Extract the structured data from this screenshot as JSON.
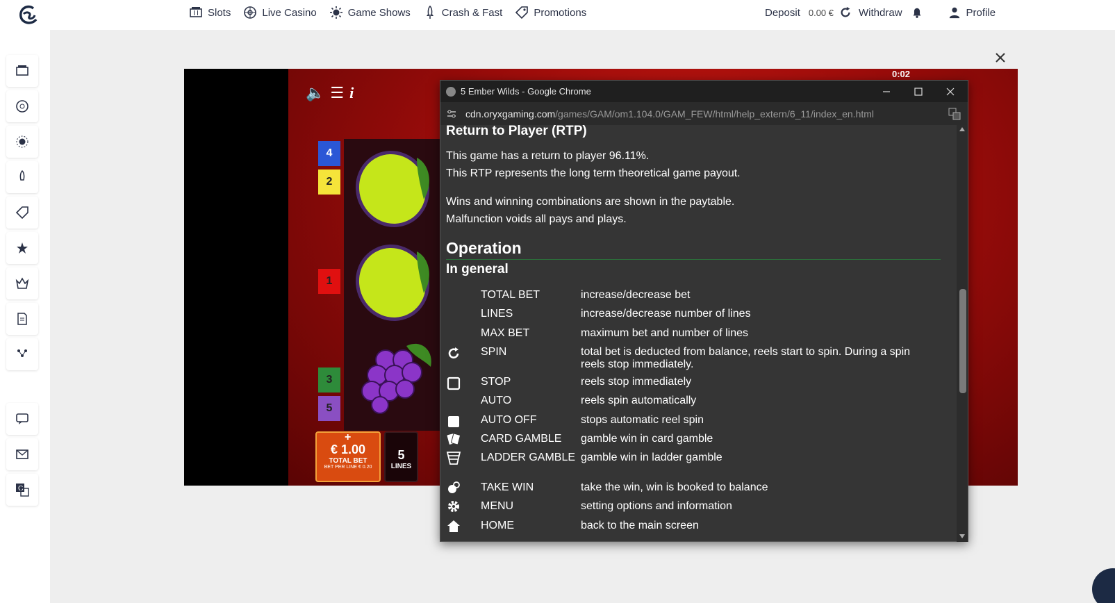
{
  "header": {
    "nav": [
      {
        "label": "Slots",
        "icon": "slot-machine-icon"
      },
      {
        "label": "Live Casino",
        "icon": "roulette-wheel-icon"
      },
      {
        "label": "Game Shows",
        "icon": "sparkle-wheel-icon"
      },
      {
        "label": "Crash & Fast",
        "icon": "rocket-icon"
      },
      {
        "label": "Promotions",
        "icon": "tag-icon"
      }
    ],
    "deposit_label": "Deposit",
    "balance": "0.00 €",
    "withdraw_label": "Withdraw",
    "profile_label": "Profile"
  },
  "sidebar": {
    "icons": [
      "slots-icon",
      "live-casino-icon",
      "game-shows-icon",
      "crash-icon",
      "promotions-icon",
      "vip-icon",
      "tournaments-icon",
      "document-icon",
      "missions-icon",
      "chat-icon",
      "mail-icon",
      "translate-icon"
    ]
  },
  "game": {
    "timer": "0:02",
    "reel_numbers": {
      "a": "4",
      "b": "2",
      "c": "1",
      "d": "3",
      "e": "5"
    },
    "bet_amount": "€ 1.00",
    "bet_label": "TOTAL BET",
    "bet_per_line": "BET PER LINE € 0.20",
    "lines_value": "5",
    "lines_label": "LINES"
  },
  "popup": {
    "title": "5 Ember Wilds - Google Chrome",
    "url_host": "cdn.oryxgaming.com",
    "url_path": "/games/GAM/om1.104.0/GAM_FEW/html/help_extern/6_11/index_en.html",
    "rtp_heading": "Return to Player (RTP)",
    "rtp_line1": "This game has a return to player 96.11%.",
    "rtp_line2": "This RTP represents the long term theoretical game payout.",
    "wins_line1": "Wins and winning combinations are shown in the paytable.",
    "wins_line2": "Malfunction voids all pays and plays.",
    "operation_heading": "Operation",
    "general_heading": "In general",
    "operations": [
      {
        "key": "TOTAL BET",
        "desc": "increase/decrease bet",
        "icon": ""
      },
      {
        "key": "LINES",
        "desc": "increase/decrease number of lines",
        "icon": ""
      },
      {
        "key": "MAX BET",
        "desc": "maximum bet and number of lines",
        "icon": ""
      },
      {
        "key": "SPIN",
        "desc": "total bet is deducted from balance, reels start to spin. During a spin reels stop immediately.",
        "icon": "refresh-icon"
      },
      {
        "key": "STOP",
        "desc": "reels stop immediately",
        "icon": "stop-square-icon"
      },
      {
        "key": "AUTO",
        "desc": "reels spin automatically",
        "icon": ""
      },
      {
        "key": "AUTO OFF",
        "desc": "stops automatic reel spin",
        "icon": "auto-off-square-icon"
      },
      {
        "key": "CARD GAMBLE",
        "desc": "gamble win in card gamble",
        "icon": "cards-icon"
      },
      {
        "key": "LADDER GAMBLE",
        "desc": "gamble win in ladder gamble",
        "icon": "ladder-icon"
      },
      {
        "key": "TAKE WIN",
        "desc": "take the win, win is booked to balance",
        "icon": "coins-icon"
      },
      {
        "key": "MENU",
        "desc": "setting options and information",
        "icon": "gear-icon"
      },
      {
        "key": "HOME",
        "desc": "back to the main screen",
        "icon": "home-icon"
      }
    ]
  }
}
